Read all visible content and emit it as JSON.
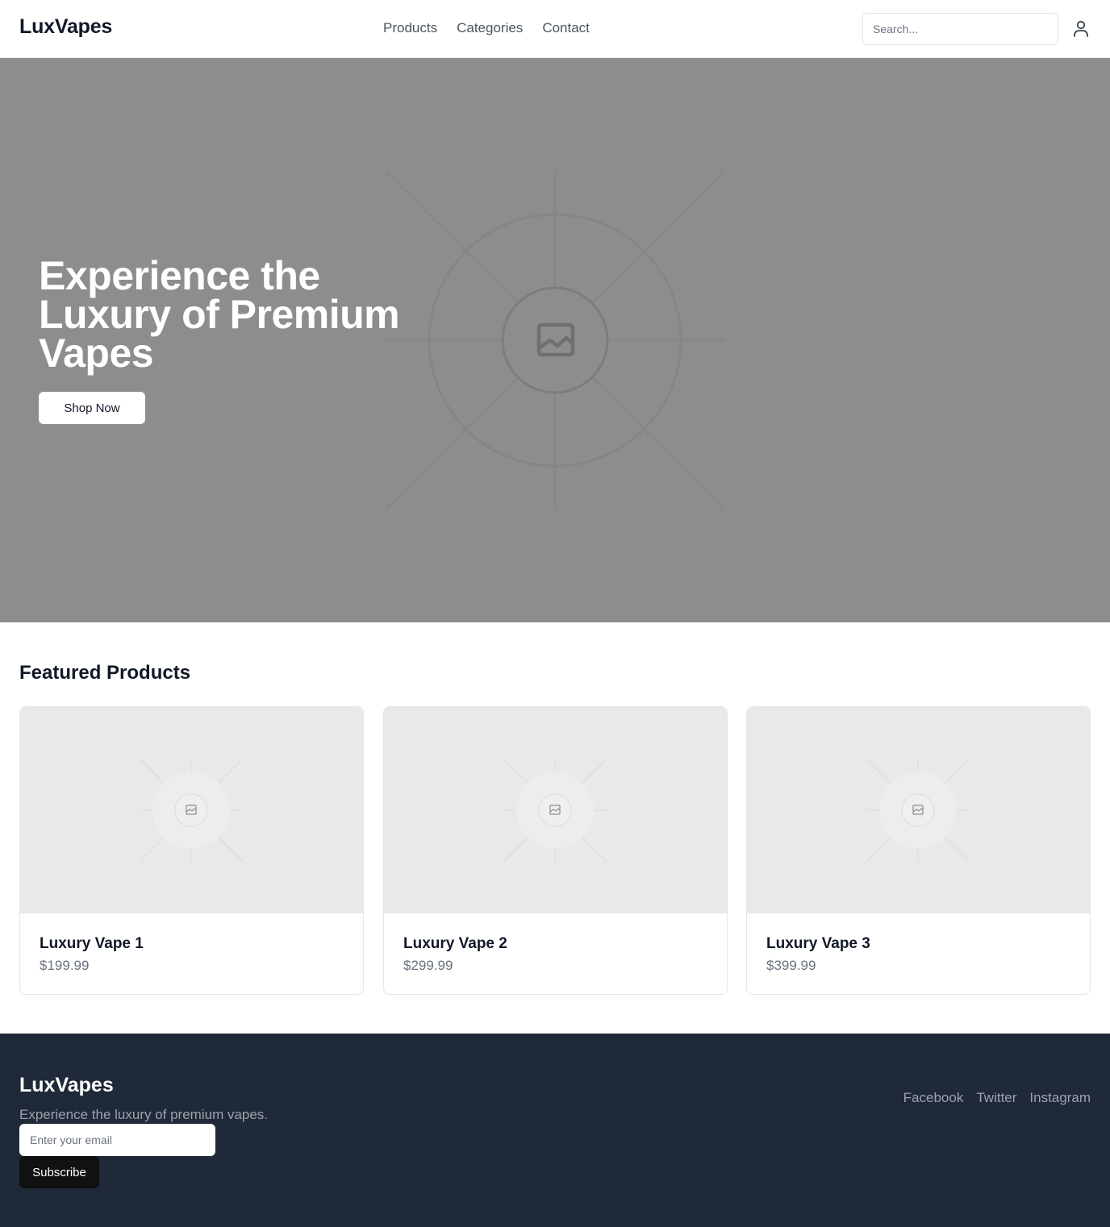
{
  "header": {
    "logo": "LuxVapes",
    "nav": [
      "Products",
      "Categories",
      "Contact"
    ],
    "search_placeholder": "Search...",
    "user_icon": "user-icon"
  },
  "hero": {
    "title": "Experience the Luxury of Premium Vapes",
    "button": "Shop Now",
    "image_icon": "image-placeholder-icon"
  },
  "featured": {
    "title": "Featured Products",
    "products": [
      {
        "name": "Luxury Vape 1",
        "price": "$199.99"
      },
      {
        "name": "Luxury Vape 2",
        "price": "$299.99"
      },
      {
        "name": "Luxury Vape 3",
        "price": "$399.99"
      }
    ]
  },
  "footer": {
    "logo": "LuxVapes",
    "tagline": "Experience the luxury of premium vapes.",
    "email_placeholder": "Enter your email",
    "subscribe": "Subscribe",
    "social": [
      "Facebook",
      "Twitter",
      "Instagram"
    ]
  },
  "colors": {
    "hero_bg": "#8d8d8d",
    "footer_bg": "#1f2937",
    "placeholder_bg": "#e9e9e9"
  }
}
